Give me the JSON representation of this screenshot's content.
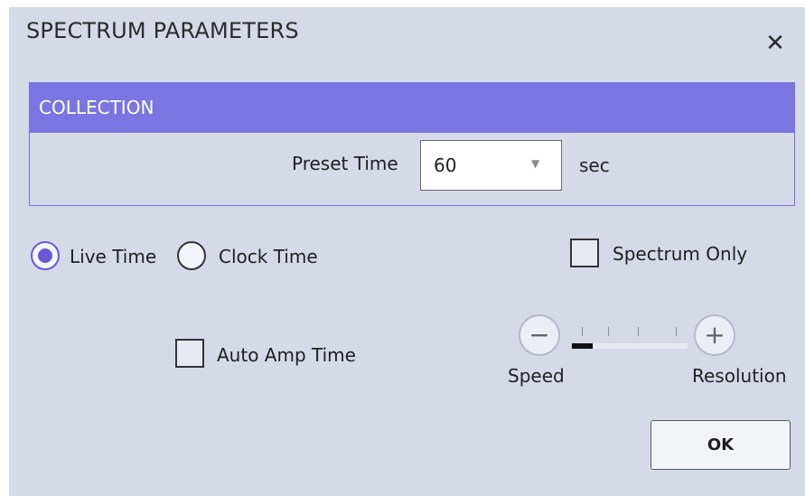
{
  "dialog": {
    "title": "SPECTRUM PARAMETERS",
    "close_glyph": "✕"
  },
  "collection": {
    "header": "COLLECTION",
    "preset_time_label": "Preset Time",
    "preset_time_value": "60",
    "preset_time_unit": "sec"
  },
  "time_mode": {
    "options": [
      {
        "label": "Live Time",
        "checked": true
      },
      {
        "label": "Clock Time",
        "checked": false
      }
    ]
  },
  "options": {
    "spectrum_only_label": "Spectrum Only",
    "spectrum_only_checked": false,
    "auto_amp_time_label": "Auto Amp Time",
    "auto_amp_time_checked": false
  },
  "slider": {
    "minus_glyph": "−",
    "plus_glyph": "+",
    "left_label": "Speed",
    "right_label": "Resolution",
    "tick_count": 4,
    "position": 0
  },
  "footer": {
    "ok_label": "OK"
  },
  "colors": {
    "accent": "#7b75e1",
    "background": "#d5d9e8",
    "radio_checked": "#6b59d7"
  }
}
